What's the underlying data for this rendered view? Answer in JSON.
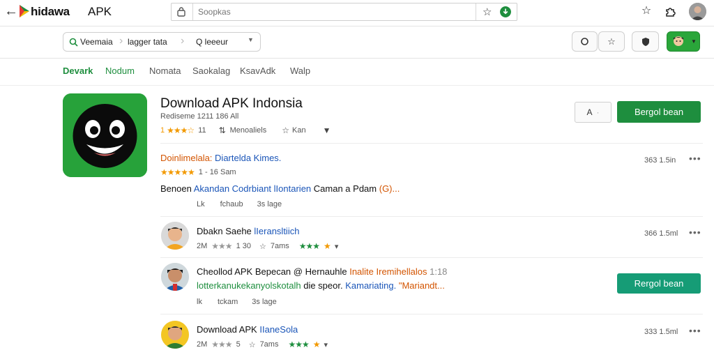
{
  "topbar": {
    "brand": "hidawa",
    "brand_sub": "APK",
    "search_placeholder": "Soopkas"
  },
  "breadcrumb": {
    "items": [
      "Veemaia",
      "lagger tata",
      "Q leeeur"
    ]
  },
  "tabs": [
    "Devark",
    "Nodum",
    "Nomata",
    "Saokalag",
    "KsavAdk",
    "Walp"
  ],
  "app": {
    "title": "Download APK Indonsia",
    "subtitle": "Rediseme 1211 186 All",
    "rating": "1",
    "rating_count": "11",
    "meta_label": "Menoaliels",
    "star_label": "Kan",
    "secondary_button": "A",
    "primary_button": "Bergol bean"
  },
  "entries": [
    {
      "title_a": "Doinlimelala:",
      "title_b": "Diartelda Kimes.",
      "line2": "1 - 16 Sam",
      "size": "363 1.5in",
      "body_a": "Benoen",
      "body_b": "Akandan Codrbiant",
      "body_c": "lIontarien",
      "body_d": "Caman a Pdam",
      "body_e": "(G)...",
      "line_action_a": "Lk",
      "line_action_b": "fchaub",
      "line_action_c": "3s lage"
    },
    {
      "title_a": "Dbakn Saehe",
      "title_b": "lIeransltiich",
      "meta_a": "2M",
      "meta_b": "1 30",
      "meta_c": "7ams",
      "size": "366 1.5ml"
    },
    {
      "title_a": "Cheollod APK Bepecan",
      "title_b": "@ Hernauhle",
      "title_c": "Inalite Iremihellalos",
      "title_d": "1:18",
      "body_a": "lotterkanukekanyolskotalh",
      "body_b": "die speor.",
      "body_c": "Kamariating.",
      "body_d": "\"Mariandt...",
      "line_action_a": "lk",
      "line_action_b": "tckam",
      "line_action_c": "3s lage",
      "button": "Rergol bean"
    },
    {
      "title_a": "Download APK",
      "title_b": "IIaneSola",
      "meta_a": "2M",
      "meta_b": "5",
      "meta_c": "7ams",
      "size": "333 1.5ml"
    }
  ]
}
